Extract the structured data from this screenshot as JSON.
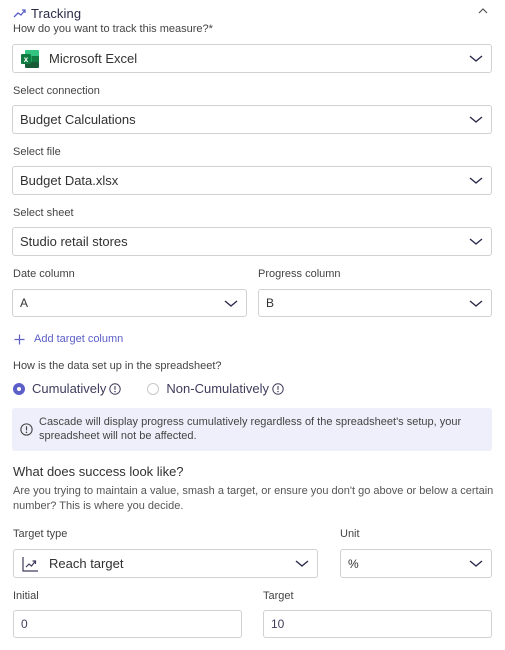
{
  "section": {
    "title": "Tracking",
    "icon": "trending-up-icon",
    "collapse_icon": "chevron-up-icon"
  },
  "tracking_method": {
    "label": "How do you want to track this measure?*",
    "value": "Microsoft Excel",
    "icon": "excel-icon"
  },
  "connection": {
    "label": "Select connection",
    "value": "Budget Calculations"
  },
  "file": {
    "label": "Select file",
    "value": "Budget Data.xlsx"
  },
  "sheet": {
    "label": "Select sheet",
    "value": "Studio retail stores"
  },
  "date_column": {
    "label": "Date column",
    "value": "A"
  },
  "progress_column": {
    "label": "Progress column",
    "value": "B"
  },
  "add_target_column": {
    "label": "Add target column"
  },
  "data_setup": {
    "label": "How is the data set up in the spreadsheet?",
    "options": [
      {
        "label": "Cumulatively",
        "selected": true
      },
      {
        "label": "Non-Cumulatively",
        "selected": false
      }
    ]
  },
  "info_banner": {
    "text": "Cascade will display progress cumulatively regardless of the spreadsheet's setup, your spreadsheet will not be affected."
  },
  "success": {
    "heading": "What does success look like?",
    "description": "Are you trying to maintain a value, smash a target, or ensure you don't go above or below a certain number? This is where you decide."
  },
  "target_type": {
    "label": "Target type",
    "value": "Reach target",
    "icon": "reach-target-icon"
  },
  "unit": {
    "label": "Unit",
    "value": "%"
  },
  "initial": {
    "label": "Initial",
    "value": "0"
  },
  "target": {
    "label": "Target",
    "value": "10"
  },
  "colors": {
    "accent": "#5b5fc7",
    "banner_bg": "#efeffb",
    "border": "#d1d1d1",
    "excel_green": "#1d7044"
  }
}
